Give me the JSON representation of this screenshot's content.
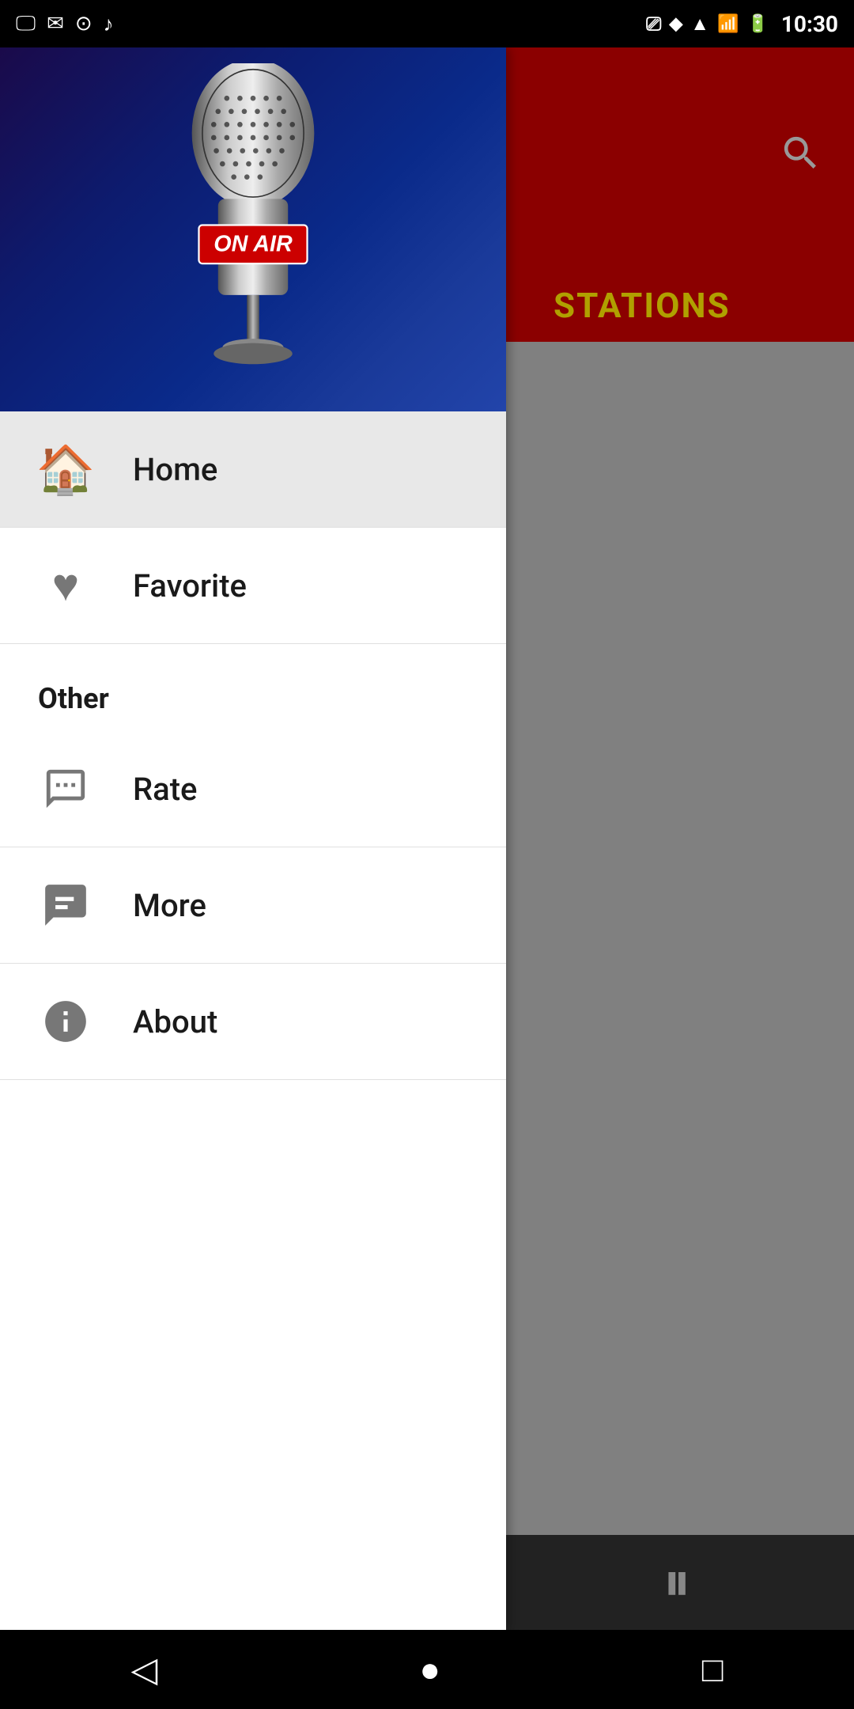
{
  "statusBar": {
    "time": "10:30",
    "icons": [
      "sim-card-icon",
      "mail-icon",
      "camera-icon",
      "music-icon",
      "cast-icon",
      "location-icon",
      "wifi-icon",
      "signal-icon",
      "battery-icon"
    ]
  },
  "drawer": {
    "heroImage": {
      "onAirText": "ON AIR"
    },
    "menuItems": [
      {
        "id": "home",
        "label": "Home",
        "icon": "home-icon",
        "active": true
      },
      {
        "id": "favorite",
        "label": "Favorite",
        "icon": "heart-icon",
        "active": false
      }
    ],
    "sections": [
      {
        "id": "other",
        "label": "Other",
        "items": [
          {
            "id": "rate",
            "label": "Rate",
            "icon": "rate-icon"
          },
          {
            "id": "more",
            "label": "More",
            "icon": "more-icon"
          },
          {
            "id": "about",
            "label": "About",
            "icon": "info-icon"
          }
        ]
      }
    ]
  },
  "rightPanel": {
    "searchLabel": "🔍",
    "title": "STATIONS",
    "pauseButton": "⏸"
  },
  "bottomNav": {
    "back": "◁",
    "home": "●",
    "recent": "□"
  }
}
